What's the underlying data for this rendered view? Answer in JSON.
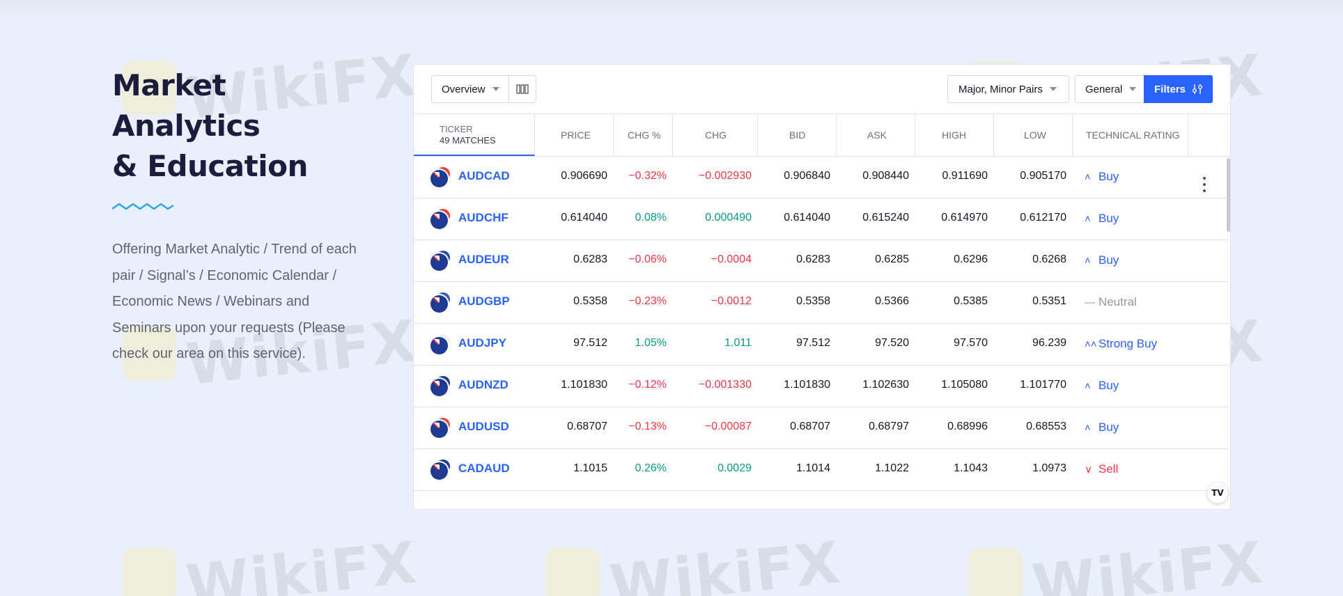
{
  "watermark_text": "WikiFX",
  "section": {
    "heading_line1": "Market Analytics",
    "heading_line2": "& Education",
    "description": "Offering Market Analytic / Trend of each pair / Signal’s / Economic Calendar / Economic News / Webinars and Seminars upon your requests (Please check our area on this service)."
  },
  "colors": {
    "accent": "#2962ff",
    "up": "#089981",
    "down": "#f23645",
    "neutral": "#9598a1",
    "wave": "#2aa6e8"
  },
  "toolbar": {
    "view": "Overview",
    "pairs": "Major, Minor Pairs",
    "category": "General",
    "filters": "Filters"
  },
  "table": {
    "ticker_header": "TICKER",
    "matches": "49 MATCHES",
    "columns": [
      "PRICE",
      "CHG %",
      "CHG",
      "BID",
      "ASK",
      "HIGH",
      "LOW",
      "TECHNICAL RATING"
    ],
    "rows": [
      {
        "ticker": "AUDCAD",
        "quote_color": "#e8413a",
        "price": "0.906690",
        "chg_pct": "−0.32%",
        "chg": "−0.002930",
        "bid": "0.906840",
        "ask": "0.908440",
        "high": "0.911690",
        "low": "0.905170",
        "rating": "Buy",
        "dir": "down",
        "rating_type": "buy"
      },
      {
        "ticker": "AUDCHF",
        "quote_color": "#e8413a",
        "price": "0.614040",
        "chg_pct": "0.08%",
        "chg": "0.000490",
        "bid": "0.614040",
        "ask": "0.615240",
        "high": "0.614970",
        "low": "0.612170",
        "rating": "Buy",
        "dir": "up",
        "rating_type": "buy"
      },
      {
        "ticker": "AUDEUR",
        "quote_color": "#1f4fa8",
        "price": "0.6283",
        "chg_pct": "−0.06%",
        "chg": "−0.0004",
        "bid": "0.6283",
        "ask": "0.6285",
        "high": "0.6296",
        "low": "0.6268",
        "rating": "Buy",
        "dir": "down",
        "rating_type": "buy"
      },
      {
        "ticker": "AUDGBP",
        "quote_color": "#3a5bb8",
        "price": "0.5358",
        "chg_pct": "−0.23%",
        "chg": "−0.0012",
        "bid": "0.5358",
        "ask": "0.5366",
        "high": "0.5385",
        "low": "0.5351",
        "rating": "Neutral",
        "dir": "down",
        "rating_type": "neutral"
      },
      {
        "ticker": "AUDJPY",
        "quote_color": "#f1f1f1",
        "price": "97.512",
        "chg_pct": "1.05%",
        "chg": "1.011",
        "bid": "97.512",
        "ask": "97.520",
        "high": "97.570",
        "low": "96.239",
        "rating": "Strong Buy",
        "dir": "up",
        "rating_type": "strong"
      },
      {
        "ticker": "AUDNZD",
        "quote_color": "#1f3a93",
        "price": "1.101830",
        "chg_pct": "−0.12%",
        "chg": "−0.001330",
        "bid": "1.101830",
        "ask": "1.102630",
        "high": "1.105080",
        "low": "1.101770",
        "rating": "Buy",
        "dir": "down",
        "rating_type": "buy"
      },
      {
        "ticker": "AUDUSD",
        "quote_color": "#d9534f",
        "price": "0.68707",
        "chg_pct": "−0.13%",
        "chg": "−0.00087",
        "bid": "0.68707",
        "ask": "0.68797",
        "high": "0.68996",
        "low": "0.68553",
        "rating": "Buy",
        "dir": "down",
        "rating_type": "buy"
      },
      {
        "ticker": "CADAUD",
        "quote_color": "#1f3a93",
        "price": "1.1015",
        "chg_pct": "0.26%",
        "chg": "0.0029",
        "bid": "1.1014",
        "ask": "1.1022",
        "high": "1.1043",
        "low": "1.0973",
        "rating": "Sell",
        "dir": "up",
        "rating_type": "sell"
      }
    ]
  }
}
